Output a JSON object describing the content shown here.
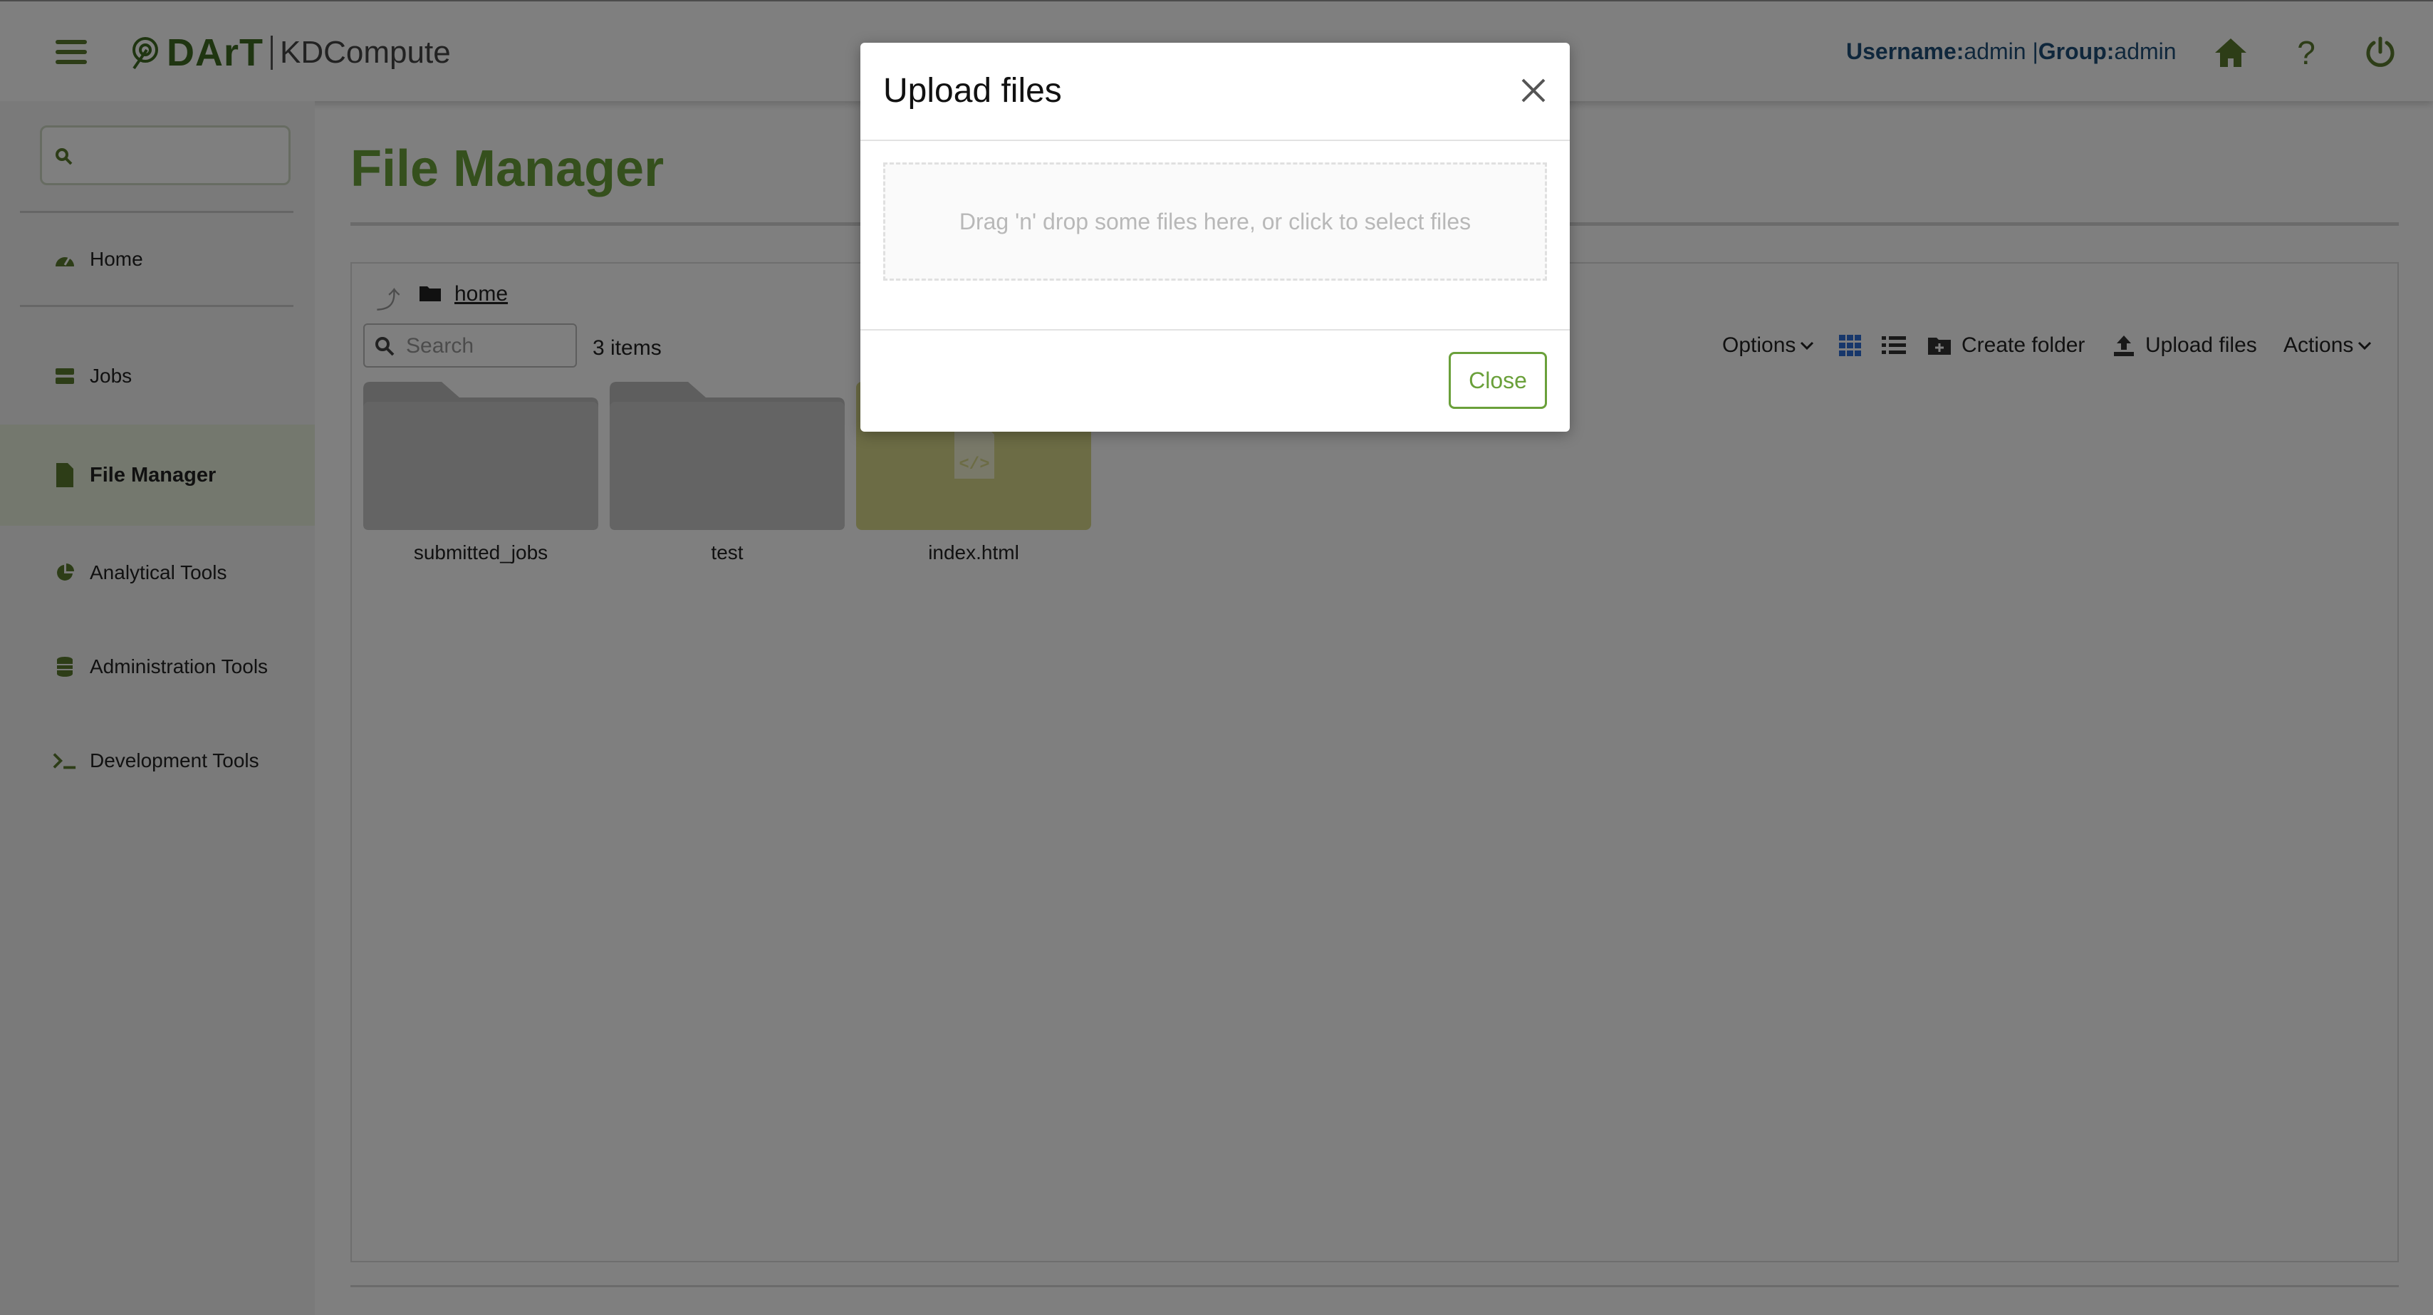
{
  "header": {
    "logo_dart": "DArT",
    "logo_product": "KDCompute",
    "username_label": "Username:",
    "username_value": "admin",
    "separator": " |",
    "group_label": "Group:",
    "group_value": "admin",
    "icons": [
      "menu-icon",
      "home-icon",
      "help-icon",
      "power-icon"
    ]
  },
  "sidebar": {
    "search_placeholder": "",
    "items": [
      {
        "label": "Home",
        "icon": "dashboard-icon"
      },
      {
        "label": "Jobs",
        "icon": "server-icon"
      },
      {
        "label": "File Manager",
        "icon": "file-icon",
        "active": true
      },
      {
        "label": "Analytical Tools",
        "icon": "pie-chart-icon"
      },
      {
        "label": "Administration Tools",
        "icon": "database-icon"
      },
      {
        "label": "Development Tools",
        "icon": "terminal-icon"
      }
    ]
  },
  "main": {
    "title": "File Manager",
    "breadcrumb": {
      "current": "home"
    },
    "search_placeholder": "Search",
    "items_count": "3 items",
    "toolbar": {
      "options": "Options",
      "create_folder": "Create folder",
      "upload_files": "Upload files",
      "actions": "Actions"
    },
    "files": [
      {
        "name": "submitted_jobs",
        "type": "folder"
      },
      {
        "name": "test",
        "type": "folder"
      },
      {
        "name": "index.html",
        "type": "file",
        "color": "#d9d98a"
      }
    ]
  },
  "modal": {
    "title": "Upload files",
    "dropzone_text": "Drag 'n' drop some files here, or click to select files",
    "close_button": "Close"
  },
  "colors": {
    "brand_green": "#6aa03a",
    "dark_green": "#3f6a22",
    "link_blue": "#1f4e79",
    "overlay": "rgba(0,0,0,0.5)"
  }
}
